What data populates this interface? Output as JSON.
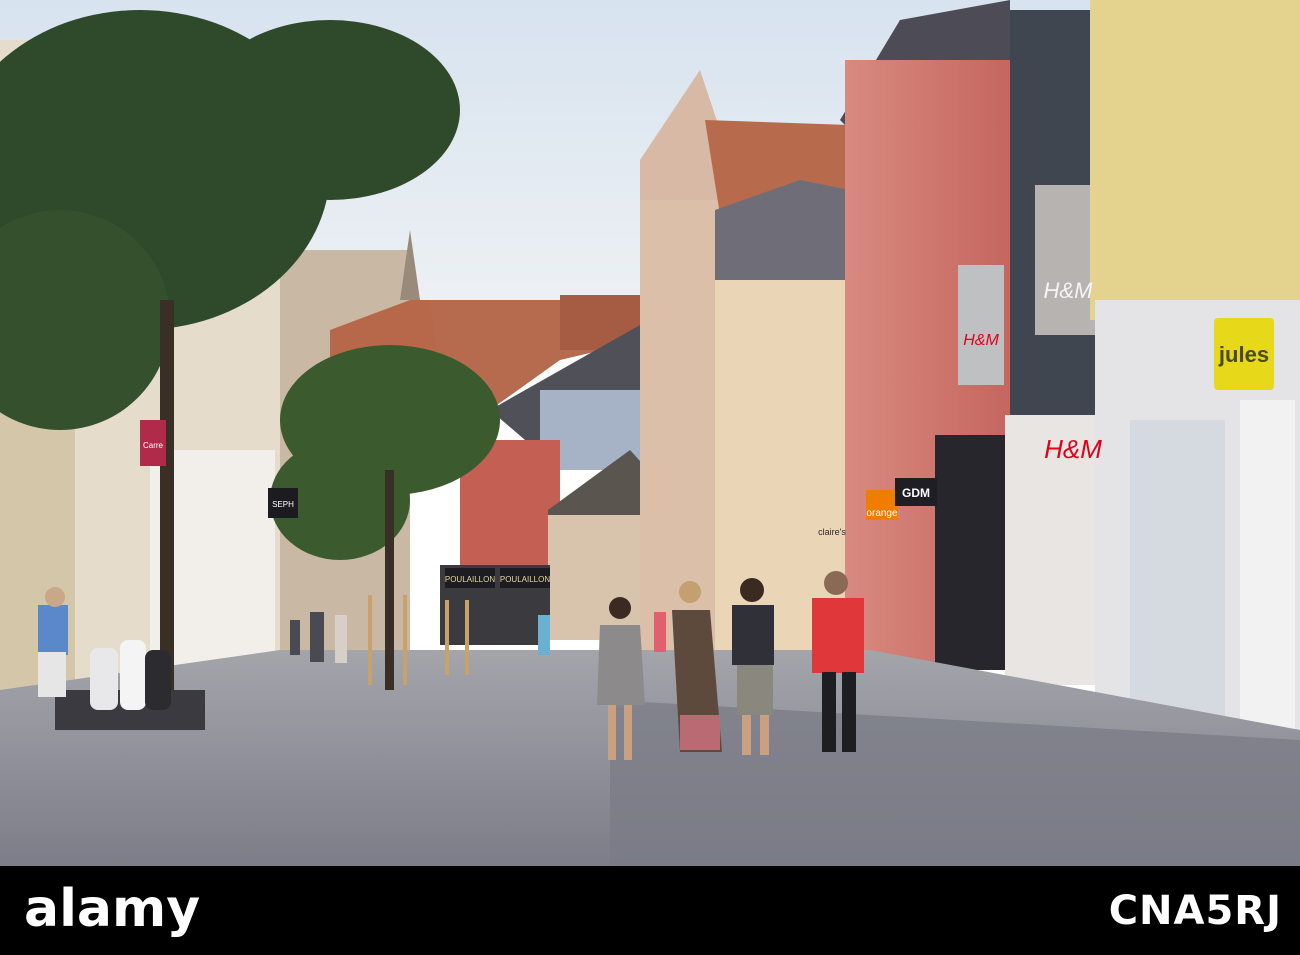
{
  "photo": {
    "description_hidden": "",
    "signs": {
      "hm_flag": "H&M",
      "hm_upper": "H&M",
      "hm_lower": "H&M",
      "jules": "jules",
      "orange": "orange",
      "gdm": "GDM",
      "claires": "claire's",
      "poulaillon_left": "POULAILLON",
      "poulaillon_right": "POULAILLON",
      "sephora": "SEPH",
      "carrefour": "Carre"
    }
  },
  "watermark": {
    "brand": "alamy",
    "image_code": "CNA5RJ"
  },
  "colors": {
    "sky": "#dfe8f1",
    "pavement": "#8a8b95",
    "pink_facade": "#c9706a",
    "cream_facade": "#e8d3b3",
    "hm_red": "#e0001a",
    "jules_yellow": "#e8d81a",
    "orange_brand": "#f07d00"
  }
}
